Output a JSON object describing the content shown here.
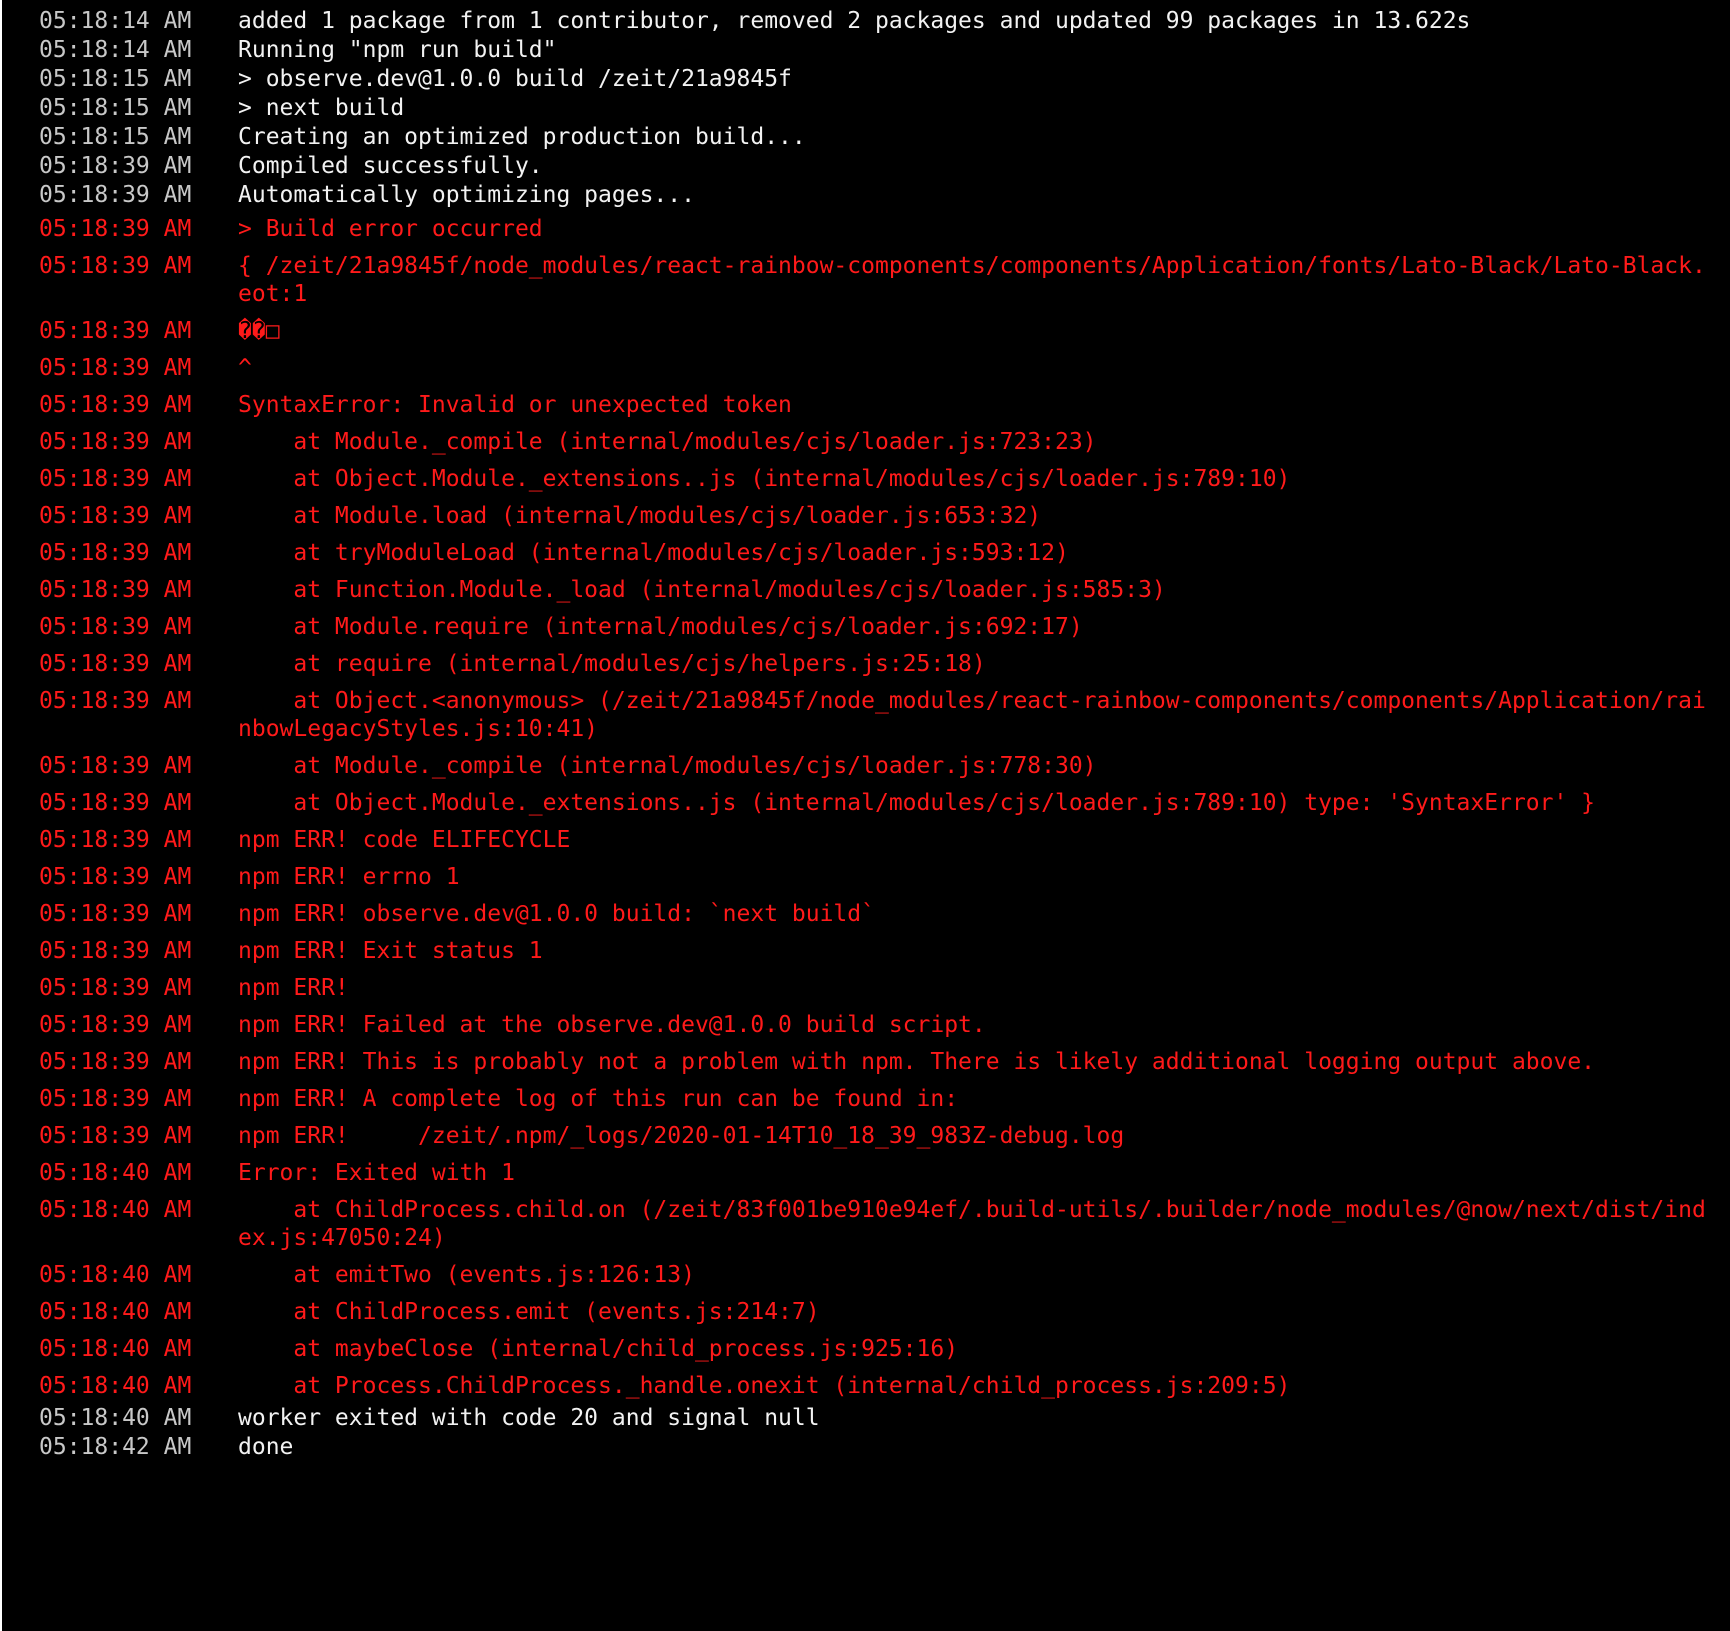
{
  "colors": {
    "background": "#000000",
    "info_text": "#f2f2f2",
    "error_text": "#ff1a1a"
  },
  "log": [
    {
      "time": "05:18:14 AM",
      "text": "added 1 package from 1 contributor, removed 2 packages and updated 99 packages in 13.622s",
      "level": "info"
    },
    {
      "time": "05:18:14 AM",
      "text": "Running \"npm run build\"",
      "level": "info"
    },
    {
      "time": "05:18:15 AM",
      "text": "> observe.dev@1.0.0 build /zeit/21a9845f",
      "level": "info"
    },
    {
      "time": "05:18:15 AM",
      "text": "> next build",
      "level": "info"
    },
    {
      "time": "05:18:15 AM",
      "text": "Creating an optimized production build...",
      "level": "info"
    },
    {
      "time": "05:18:39 AM",
      "text": "Compiled successfully.",
      "level": "info"
    },
    {
      "time": "05:18:39 AM",
      "text": "Automatically optimizing pages...",
      "level": "info"
    },
    {
      "time": "05:18:39 AM",
      "text": "> Build error occurred",
      "level": "error"
    },
    {
      "time": "05:18:39 AM",
      "text": "{ /zeit/21a9845f/node_modules/react-rainbow-components/components/Application/fonts/Lato-Black/Lato-Black.eot:1",
      "level": "error"
    },
    {
      "time": "05:18:39 AM",
      "text": "��□",
      "level": "error"
    },
    {
      "time": "05:18:39 AM",
      "text": "^",
      "level": "error"
    },
    {
      "time": "05:18:39 AM",
      "text": "SyntaxError: Invalid or unexpected token",
      "level": "error"
    },
    {
      "time": "05:18:39 AM",
      "text": "    at Module._compile (internal/modules/cjs/loader.js:723:23)",
      "level": "error"
    },
    {
      "time": "05:18:39 AM",
      "text": "    at Object.Module._extensions..js (internal/modules/cjs/loader.js:789:10)",
      "level": "error"
    },
    {
      "time": "05:18:39 AM",
      "text": "    at Module.load (internal/modules/cjs/loader.js:653:32)",
      "level": "error"
    },
    {
      "time": "05:18:39 AM",
      "text": "    at tryModuleLoad (internal/modules/cjs/loader.js:593:12)",
      "level": "error"
    },
    {
      "time": "05:18:39 AM",
      "text": "    at Function.Module._load (internal/modules/cjs/loader.js:585:3)",
      "level": "error"
    },
    {
      "time": "05:18:39 AM",
      "text": "    at Module.require (internal/modules/cjs/loader.js:692:17)",
      "level": "error"
    },
    {
      "time": "05:18:39 AM",
      "text": "    at require (internal/modules/cjs/helpers.js:25:18)",
      "level": "error"
    },
    {
      "time": "05:18:39 AM",
      "text": "    at Object.<anonymous> (/zeit/21a9845f/node_modules/react-rainbow-components/components/Application/rainbowLegacyStyles.js:10:41)",
      "level": "error"
    },
    {
      "time": "05:18:39 AM",
      "text": "    at Module._compile (internal/modules/cjs/loader.js:778:30)",
      "level": "error"
    },
    {
      "time": "05:18:39 AM",
      "text": "    at Object.Module._extensions..js (internal/modules/cjs/loader.js:789:10) type: 'SyntaxError' }",
      "level": "error"
    },
    {
      "time": "05:18:39 AM",
      "text": "npm ERR! code ELIFECYCLE",
      "level": "error"
    },
    {
      "time": "05:18:39 AM",
      "text": "npm ERR! errno 1",
      "level": "error"
    },
    {
      "time": "05:18:39 AM",
      "text": "npm ERR! observe.dev@1.0.0 build: `next build`",
      "level": "error"
    },
    {
      "time": "05:18:39 AM",
      "text": "npm ERR! Exit status 1",
      "level": "error"
    },
    {
      "time": "05:18:39 AM",
      "text": "npm ERR!",
      "level": "error"
    },
    {
      "time": "05:18:39 AM",
      "text": "npm ERR! Failed at the observe.dev@1.0.0 build script.",
      "level": "error"
    },
    {
      "time": "05:18:39 AM",
      "text": "npm ERR! This is probably not a problem with npm. There is likely additional logging output above.",
      "level": "error"
    },
    {
      "time": "05:18:39 AM",
      "text": "npm ERR! A complete log of this run can be found in:",
      "level": "error"
    },
    {
      "time": "05:18:39 AM",
      "text": "npm ERR!     /zeit/.npm/_logs/2020-01-14T10_18_39_983Z-debug.log",
      "level": "error"
    },
    {
      "time": "05:18:40 AM",
      "text": "Error: Exited with 1",
      "level": "error"
    },
    {
      "time": "05:18:40 AM",
      "text": "    at ChildProcess.child.on (/zeit/83f001be910e94ef/.build-utils/.builder/node_modules/@now/next/dist/index.js:47050:24)",
      "level": "error"
    },
    {
      "time": "05:18:40 AM",
      "text": "    at emitTwo (events.js:126:13)",
      "level": "error"
    },
    {
      "time": "05:18:40 AM",
      "text": "    at ChildProcess.emit (events.js:214:7)",
      "level": "error"
    },
    {
      "time": "05:18:40 AM",
      "text": "    at maybeClose (internal/child_process.js:925:16)",
      "level": "error"
    },
    {
      "time": "05:18:40 AM",
      "text": "    at Process.ChildProcess._handle.onexit (internal/child_process.js:209:5)",
      "level": "error"
    },
    {
      "time": "05:18:40 AM",
      "text": "worker exited with code 20 and signal null",
      "level": "info"
    },
    {
      "time": "05:18:42 AM",
      "text": "done",
      "level": "info"
    }
  ]
}
